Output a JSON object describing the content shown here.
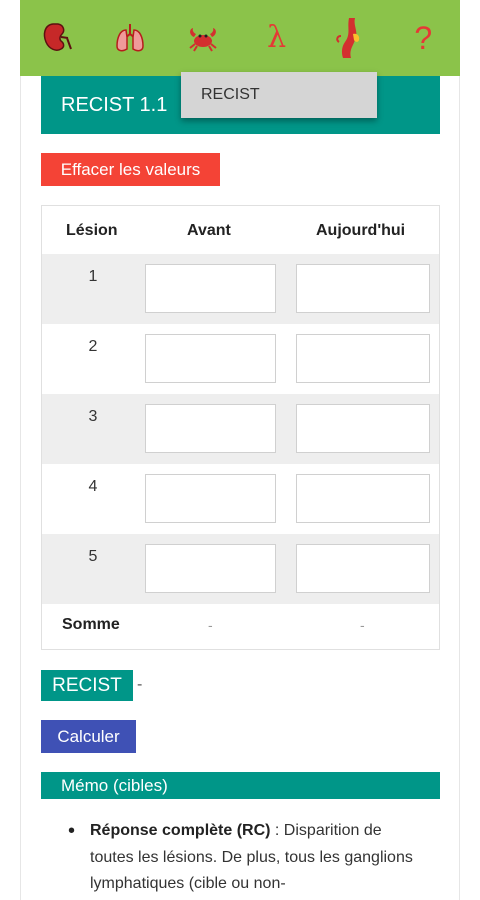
{
  "toolbar": {
    "lambda_glyph": "λ",
    "help_glyph": "?"
  },
  "header": {
    "title": "RECIST 1.1"
  },
  "dropdown": {
    "item": "RECIST"
  },
  "actions": {
    "clear_label": "Effacer les valeurs",
    "calculate_label": "Calculer"
  },
  "table": {
    "columns": [
      "Lésion",
      "Avant",
      "Aujourd'hui"
    ],
    "rows": [
      {
        "label": "1",
        "before": "",
        "today": ""
      },
      {
        "label": "2",
        "before": "",
        "today": ""
      },
      {
        "label": "3",
        "before": "",
        "today": ""
      },
      {
        "label": "4",
        "before": "",
        "today": ""
      },
      {
        "label": "5",
        "before": "",
        "today": ""
      }
    ],
    "sum_label": "Somme",
    "sum_before": "-",
    "sum_today": "-"
  },
  "result": {
    "badge": "RECIST",
    "value": "-"
  },
  "memo": {
    "title": "Mémo (cibles)",
    "items": [
      {
        "term": "Réponse complète (RC)",
        "text": " : Disparition de toutes les lésions. De plus, tous les ganglions lymphatiques (cible ou non-"
      }
    ]
  },
  "colors": {
    "toolbar_bg": "#8bc34a",
    "icon_red": "#e53935",
    "teal": "#009688",
    "clear_red": "#f44336",
    "calc_blue": "#3f51b5"
  },
  "icons": [
    "kidney-icon",
    "lungs-icon",
    "crab-icon",
    "lambda-icon",
    "vessel-icon",
    "help-icon"
  ]
}
